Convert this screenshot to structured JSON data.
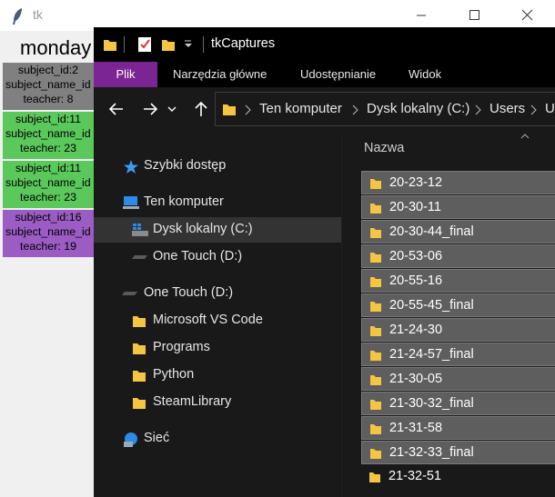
{
  "tk_window": {
    "title": "tk",
    "day_label": "monday",
    "cards": [
      {
        "line1": "subject_id:2",
        "line2": "subject_name_id",
        "line3": "teacher: 8",
        "color": "#808080"
      },
      {
        "line1": "subject_id:11",
        "line2": "subject_name_id",
        "line3": "teacher: 23",
        "color": "#5ac85a"
      },
      {
        "line1": "subject_id:11",
        "line2": "subject_name_id",
        "line3": "teacher: 23",
        "color": "#5ac85a"
      },
      {
        "line1": "subject_id:16",
        "line2": "subject_name_id",
        "line3": "teacher: 19",
        "color": "#9b5cc4"
      }
    ],
    "controls": {
      "minimize_icon": "minimize-icon",
      "maximize_icon": "maximize-icon",
      "close_icon": "close-icon"
    }
  },
  "explorer": {
    "title": "tkCaptures",
    "ribbon_tabs": [
      "Plik",
      "Narzędzia główne",
      "Udostępnianie",
      "Widok"
    ],
    "active_tab_color": "#7b2594",
    "address_crumbs": [
      "Ten komputer",
      "Dysk lokalny (C:)",
      "Users",
      "U"
    ],
    "nav_items": [
      {
        "label": "Szybki dostęp",
        "icon": "star-icon"
      },
      {
        "label": "Ten komputer",
        "icon": "computer-icon"
      },
      {
        "label": "Dysk lokalny (C:)",
        "icon": "windows-drive-icon",
        "selected": true
      },
      {
        "label": "One Touch (D:)",
        "icon": "drive-icon"
      },
      {
        "label": "One Touch (D:)",
        "icon": "drive-icon"
      },
      {
        "label": "Microsoft VS Code",
        "icon": "folder-icon"
      },
      {
        "label": "Programs",
        "icon": "folder-icon"
      },
      {
        "label": "Python",
        "icon": "folder-icon"
      },
      {
        "label": "SteamLibrary",
        "icon": "folder-icon"
      },
      {
        "label": "Sieć",
        "icon": "network-icon"
      }
    ],
    "column_header": "Nazwa",
    "files": [
      {
        "name": "20-23-12",
        "selected": true
      },
      {
        "name": "20-30-11",
        "selected": true
      },
      {
        "name": "20-30-44_final",
        "selected": true
      },
      {
        "name": "20-53-06",
        "selected": true
      },
      {
        "name": "20-55-16",
        "selected": true
      },
      {
        "name": "20-55-45_final",
        "selected": true
      },
      {
        "name": "21-24-30",
        "selected": true
      },
      {
        "name": "21-24-57_final",
        "selected": true
      },
      {
        "name": "21-30-05",
        "selected": true
      },
      {
        "name": "21-30-32_final",
        "selected": true
      },
      {
        "name": "21-31-58",
        "selected": true
      },
      {
        "name": "21-32-33_final",
        "selected": true
      },
      {
        "name": "21-32-51",
        "selected": false
      }
    ]
  }
}
